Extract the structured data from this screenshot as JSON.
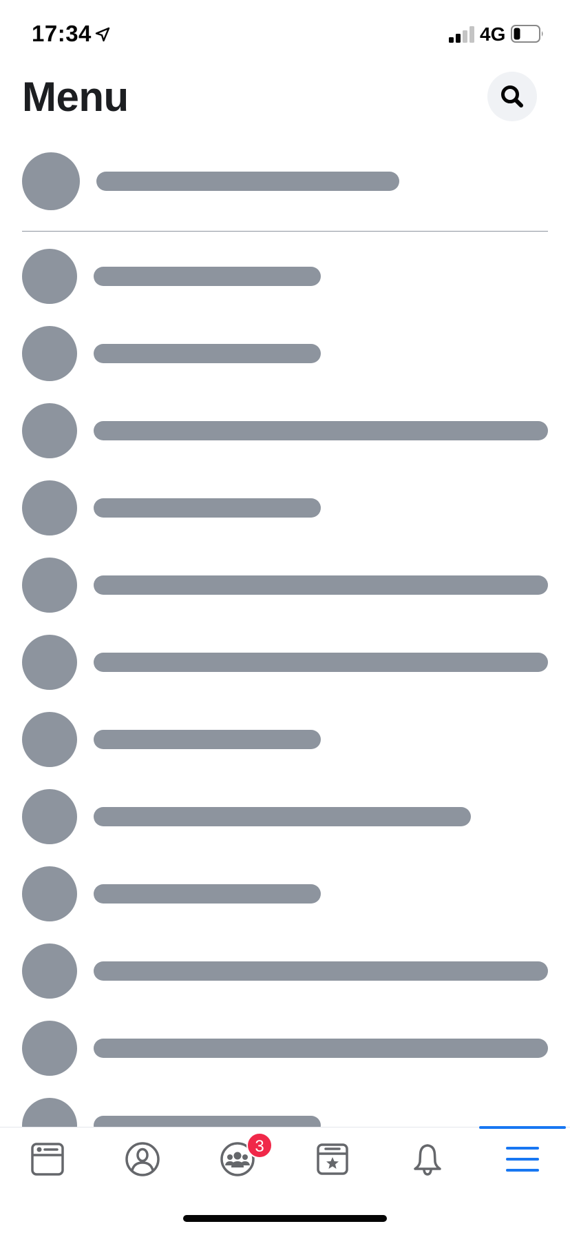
{
  "status_bar": {
    "time": "17:34",
    "network": "4G",
    "icons": [
      "location-arrow-icon",
      "signal-icon",
      "battery-icon"
    ]
  },
  "header": {
    "title": "Menu",
    "search_icon": "search-icon"
  },
  "profile": {
    "avatar": "placeholder-avatar",
    "name": ""
  },
  "menu": {
    "items": [
      {
        "name": "menu-item-1",
        "bar": "short"
      },
      {
        "name": "menu-item-2",
        "bar": "short"
      },
      {
        "name": "menu-item-3",
        "bar": "long"
      },
      {
        "name": "menu-item-4",
        "bar": "short"
      },
      {
        "name": "menu-item-5",
        "bar": "long"
      },
      {
        "name": "menu-item-6",
        "bar": "long"
      },
      {
        "name": "menu-item-7",
        "bar": "short"
      },
      {
        "name": "menu-item-8",
        "bar": "medium"
      },
      {
        "name": "menu-item-9",
        "bar": "short"
      },
      {
        "name": "menu-item-10",
        "bar": "long"
      },
      {
        "name": "menu-item-11",
        "bar": "long"
      },
      {
        "name": "menu-item-12",
        "bar": "short"
      }
    ]
  },
  "tab_bar": {
    "active_tab": "menu",
    "tabs": [
      {
        "id": "feed",
        "icon": "news-feed-icon"
      },
      {
        "id": "profile",
        "icon": "profile-icon"
      },
      {
        "id": "groups",
        "icon": "groups-icon",
        "badge": "3"
      },
      {
        "id": "pages",
        "icon": "pages-icon"
      },
      {
        "id": "notifications",
        "icon": "bell-icon"
      },
      {
        "id": "menu",
        "icon": "hamburger-menu-icon"
      }
    ]
  },
  "colors": {
    "placeholder": "#8d949e",
    "accent": "#1877f2",
    "badge": "#f02849",
    "search_bg": "#f0f2f5",
    "text": "#1c1e21"
  }
}
